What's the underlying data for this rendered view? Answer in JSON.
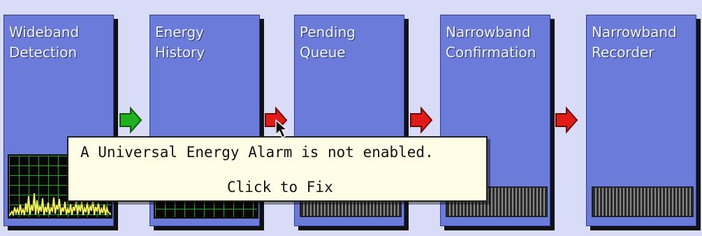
{
  "panels": [
    {
      "title": "Wideband\nDetection"
    },
    {
      "title": "Energy\nHistory"
    },
    {
      "title": "Pending\nQueue"
    },
    {
      "title": "Narrowband\nConfirmation"
    },
    {
      "title": "Narrowband\nRecorder"
    }
  ],
  "arrows": [
    {
      "color": "#23b020"
    },
    {
      "color": "#e11b18"
    },
    {
      "color": "#e11b18"
    },
    {
      "color": "#e11b18"
    }
  ],
  "tooltip": {
    "message": "A Universal Energy Alarm is not enabled.",
    "action": "Click to Fix"
  },
  "icons": {
    "cursor": "mouse-pointer-icon",
    "green_arrow": "right-arrow-icon",
    "red_arrow": "right-arrow-icon"
  }
}
